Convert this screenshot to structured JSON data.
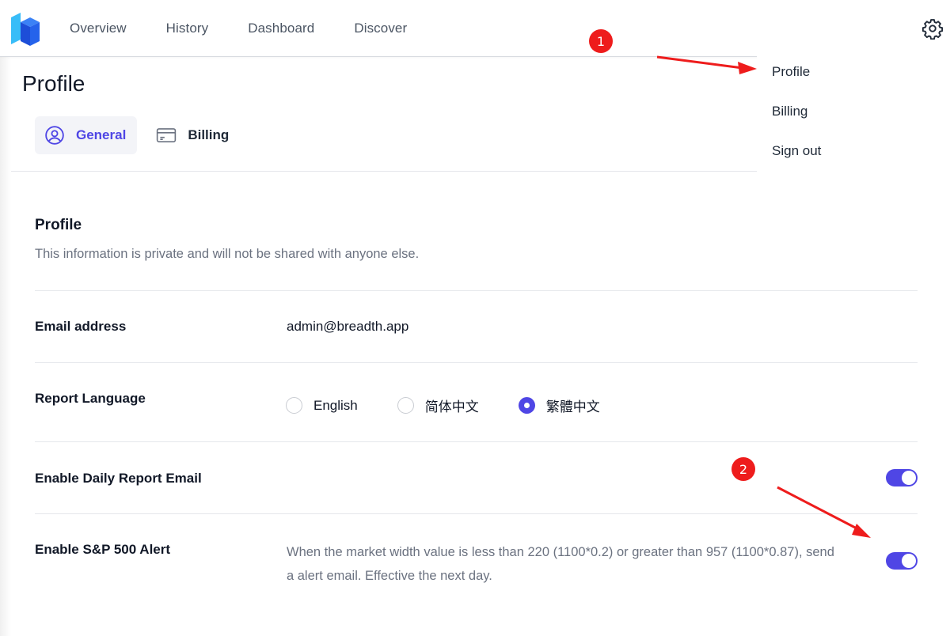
{
  "nav": {
    "items": [
      "Overview",
      "History",
      "Dashboard",
      "Discover"
    ]
  },
  "page": {
    "title": "Profile"
  },
  "tabs": [
    {
      "label": "General",
      "icon": "user-circle-icon",
      "active": true
    },
    {
      "label": "Billing",
      "icon": "credit-card-icon",
      "active": false
    }
  ],
  "dropdown": {
    "items": [
      "Profile",
      "Billing",
      "Sign out"
    ]
  },
  "section": {
    "title": "Profile",
    "description": "This information is private and will not be shared with anyone else."
  },
  "rows": {
    "email": {
      "label": "Email address",
      "value": "admin@breadth.app"
    },
    "language": {
      "label": "Report Language",
      "options": [
        "English",
        "简体中文",
        "繁體中文"
      ],
      "selected": "繁體中文"
    },
    "daily_email": {
      "label": "Enable Daily Report Email",
      "enabled": true
    },
    "sp500": {
      "label": "Enable S&P 500 Alert",
      "description_line1": "When the market width value is less than 220 (1100*0.2) or greater than 957 (1100*0.87), send",
      "description_line2": "a alert email. Effective the next day.",
      "enabled": true
    }
  },
  "annotations": {
    "marker1": "1",
    "marker2": "2"
  },
  "colors": {
    "accent": "#4f46e5",
    "annotation": "#ee1c1c",
    "muted_text": "#6b7280"
  }
}
